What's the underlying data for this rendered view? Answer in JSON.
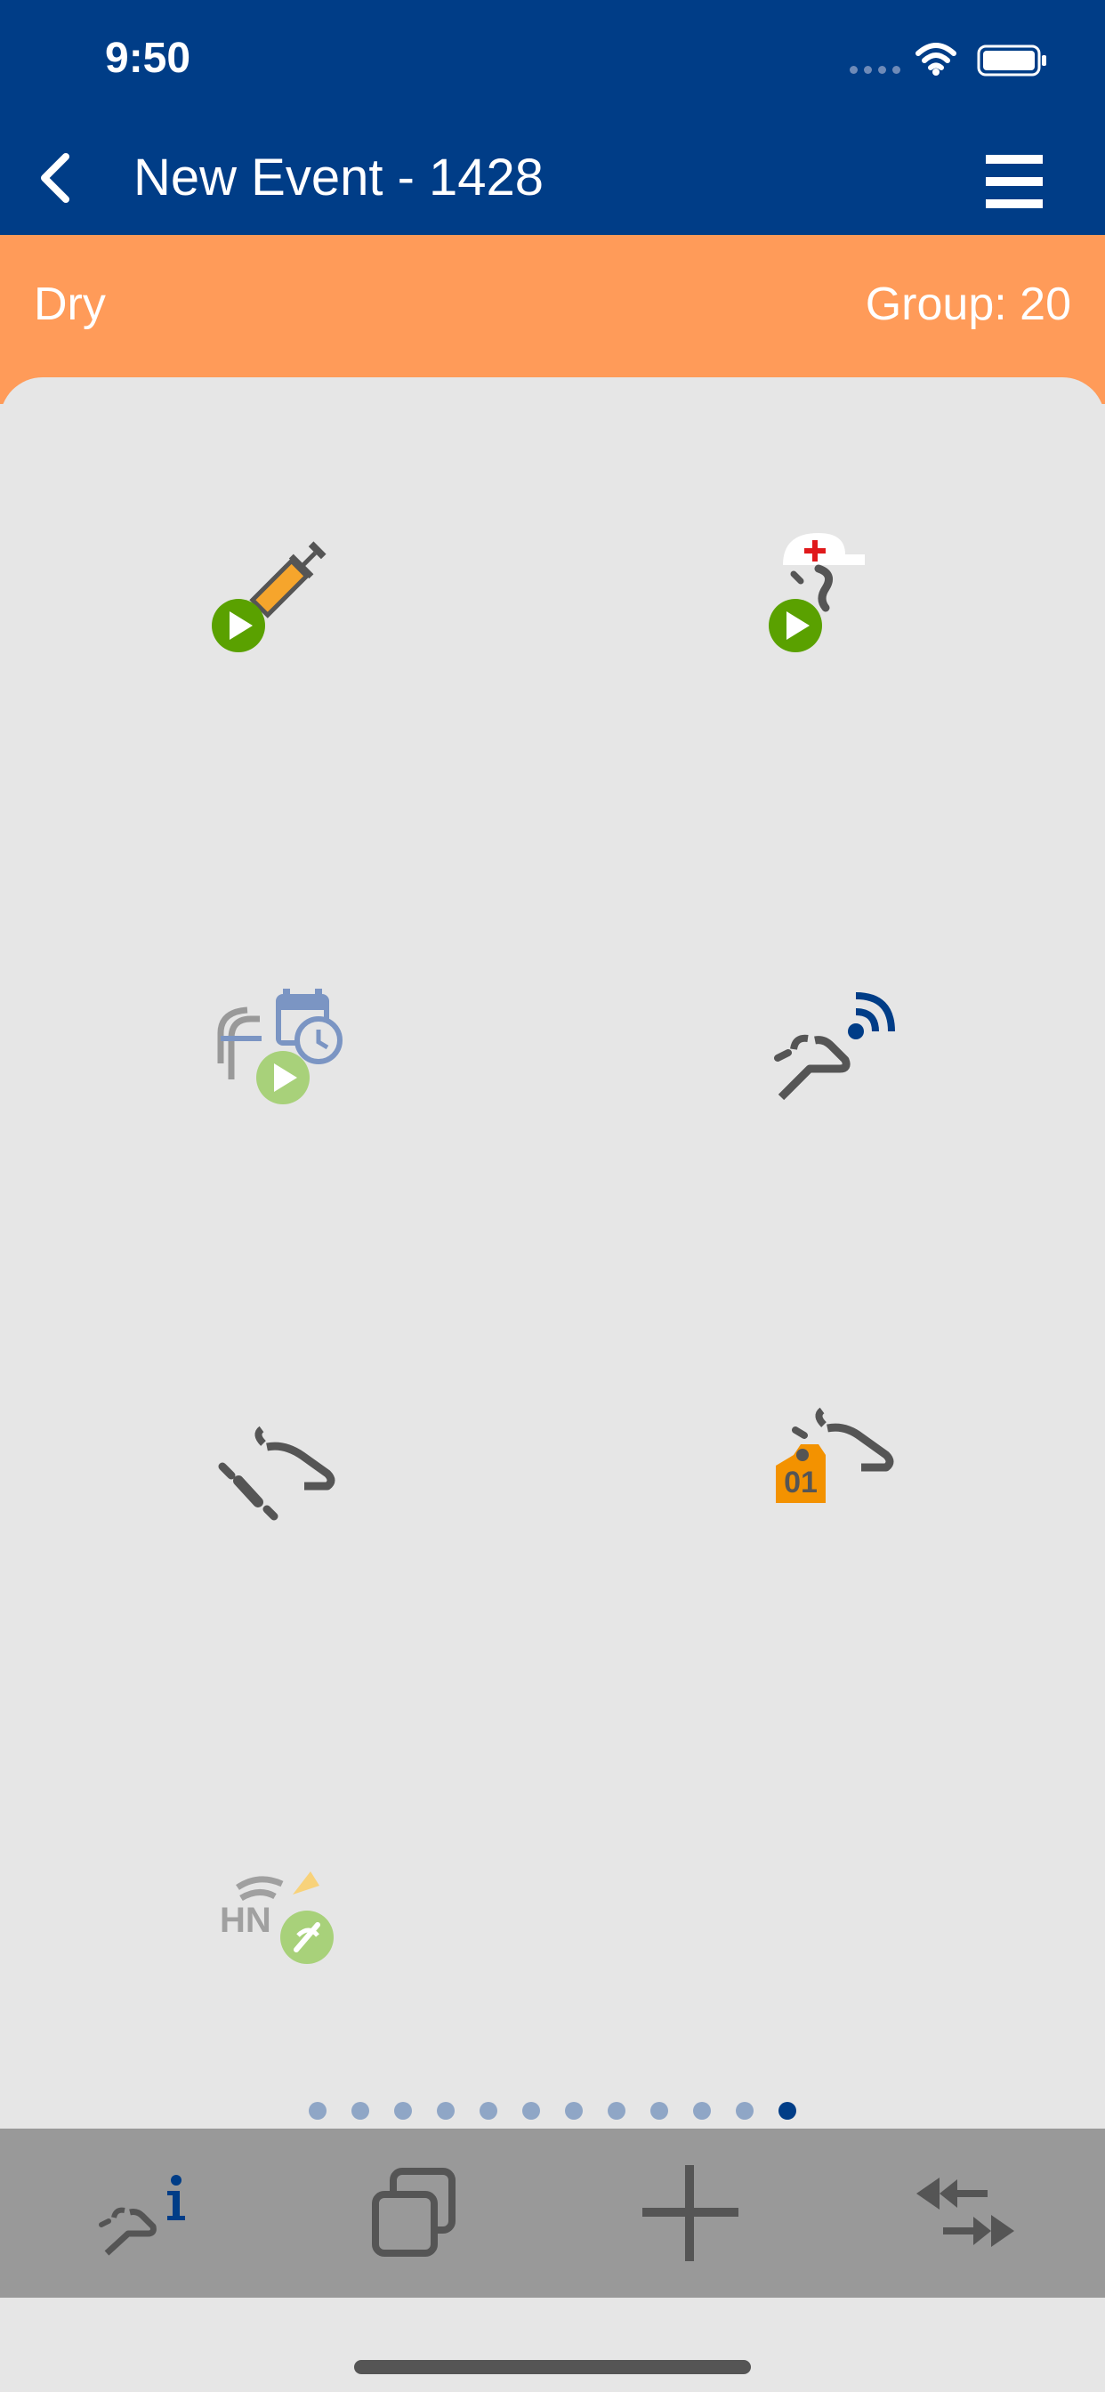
{
  "status_bar": {
    "time": "9:50",
    "icons": [
      "signal-dots-icon",
      "wifi-icon",
      "battery-icon"
    ]
  },
  "nav": {
    "title": "New Event - 1428",
    "back_icon": "chevron-left-icon",
    "menu_icon": "hamburger-menu-icon"
  },
  "state": {
    "left": "Dry",
    "right": "Group: 20"
  },
  "tiles": [
    {
      "icon": "syringe-start-icon"
    },
    {
      "icon": "vet-check-start-icon"
    },
    {
      "icon": "scheduled-treatment-start-icon"
    },
    {
      "icon": "cow-sensor-icon"
    },
    {
      "icon": "cow-remove-icon"
    },
    {
      "icon": "cow-ear-tag-icon",
      "tag_text": "01"
    },
    {
      "icon": "hn-tag-icon",
      "tag_text": "HN"
    }
  ],
  "pagination": {
    "total": 12,
    "active": 12
  },
  "toolbar": {
    "items": [
      "cow-info-icon",
      "copy-icon",
      "add-icon",
      "swap-arrows-icon"
    ]
  },
  "colors": {
    "header": "#003d87",
    "state_bar": "#ff9b59",
    "panel": "#e6e6e6",
    "toolbar": "#999999",
    "play_green": "#5aa100",
    "icon_gray": "#555555",
    "tag_orange": "#f39200"
  }
}
